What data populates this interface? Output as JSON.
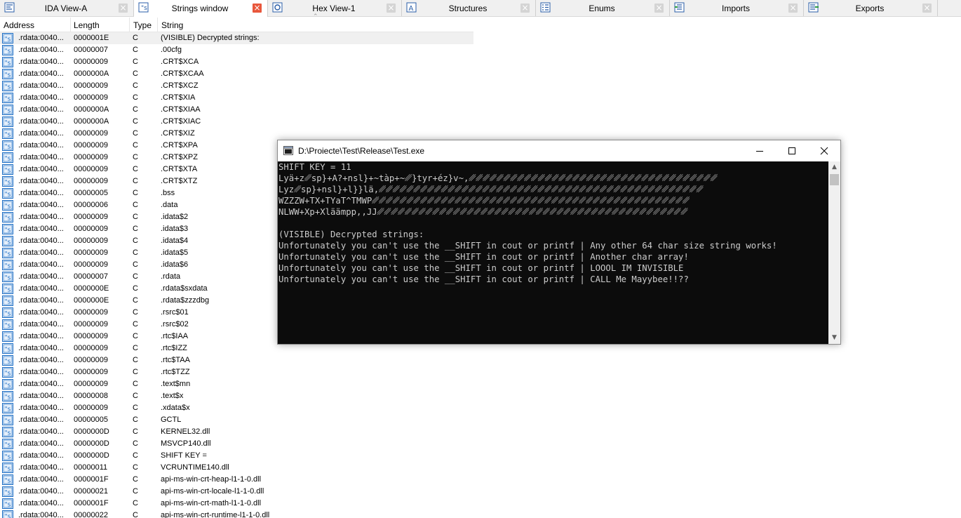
{
  "tabs": [
    {
      "label": "IDA View-A",
      "icon": "ida-view-icon",
      "active": false
    },
    {
      "label": "Strings window",
      "icon": "strings-icon",
      "active": true
    },
    {
      "label": "Hex View-1",
      "icon": "hex-view-icon",
      "active": false
    },
    {
      "label": "Structures",
      "icon": "structures-icon",
      "active": false
    },
    {
      "label": "Enums",
      "icon": "enums-icon",
      "active": false
    },
    {
      "label": "Imports",
      "icon": "imports-icon",
      "active": false
    },
    {
      "label": "Exports",
      "icon": "exports-icon",
      "active": false
    }
  ],
  "strings_table": {
    "columns": [
      "Address",
      "Length",
      "Type",
      "String"
    ],
    "rows": [
      {
        "address": ".rdata:0040...",
        "length": "0000001E",
        "type": "C",
        "string": "(VISIBLE) Decrypted strings:"
      },
      {
        "address": ".rdata:0040...",
        "length": "00000007",
        "type": "C",
        "string": ".00cfg"
      },
      {
        "address": ".rdata:0040...",
        "length": "00000009",
        "type": "C",
        "string": ".CRT$XCA"
      },
      {
        "address": ".rdata:0040...",
        "length": "0000000A",
        "type": "C",
        "string": ".CRT$XCAA"
      },
      {
        "address": ".rdata:0040...",
        "length": "00000009",
        "type": "C",
        "string": ".CRT$XCZ"
      },
      {
        "address": ".rdata:0040...",
        "length": "00000009",
        "type": "C",
        "string": ".CRT$XIA"
      },
      {
        "address": ".rdata:0040...",
        "length": "0000000A",
        "type": "C",
        "string": ".CRT$XIAA"
      },
      {
        "address": ".rdata:0040...",
        "length": "0000000A",
        "type": "C",
        "string": ".CRT$XIAC"
      },
      {
        "address": ".rdata:0040...",
        "length": "00000009",
        "type": "C",
        "string": ".CRT$XIZ"
      },
      {
        "address": ".rdata:0040...",
        "length": "00000009",
        "type": "C",
        "string": ".CRT$XPA"
      },
      {
        "address": ".rdata:0040...",
        "length": "00000009",
        "type": "C",
        "string": ".CRT$XPZ"
      },
      {
        "address": ".rdata:0040...",
        "length": "00000009",
        "type": "C",
        "string": ".CRT$XTA"
      },
      {
        "address": ".rdata:0040...",
        "length": "00000009",
        "type": "C",
        "string": ".CRT$XTZ"
      },
      {
        "address": ".rdata:0040...",
        "length": "00000005",
        "type": "C",
        "string": ".bss"
      },
      {
        "address": ".rdata:0040...",
        "length": "00000006",
        "type": "C",
        "string": ".data"
      },
      {
        "address": ".rdata:0040...",
        "length": "00000009",
        "type": "C",
        "string": ".idata$2"
      },
      {
        "address": ".rdata:0040...",
        "length": "00000009",
        "type": "C",
        "string": ".idata$3"
      },
      {
        "address": ".rdata:0040...",
        "length": "00000009",
        "type": "C",
        "string": ".idata$4"
      },
      {
        "address": ".rdata:0040...",
        "length": "00000009",
        "type": "C",
        "string": ".idata$5"
      },
      {
        "address": ".rdata:0040...",
        "length": "00000009",
        "type": "C",
        "string": ".idata$6"
      },
      {
        "address": ".rdata:0040...",
        "length": "00000007",
        "type": "C",
        "string": ".rdata"
      },
      {
        "address": ".rdata:0040...",
        "length": "0000000E",
        "type": "C",
        "string": ".rdata$sxdata"
      },
      {
        "address": ".rdata:0040...",
        "length": "0000000E",
        "type": "C",
        "string": ".rdata$zzzdbg"
      },
      {
        "address": ".rdata:0040...",
        "length": "00000009",
        "type": "C",
        "string": ".rsrc$01"
      },
      {
        "address": ".rdata:0040...",
        "length": "00000009",
        "type": "C",
        "string": ".rsrc$02"
      },
      {
        "address": ".rdata:0040...",
        "length": "00000009",
        "type": "C",
        "string": ".rtc$IAA"
      },
      {
        "address": ".rdata:0040...",
        "length": "00000009",
        "type": "C",
        "string": ".rtc$IZZ"
      },
      {
        "address": ".rdata:0040...",
        "length": "00000009",
        "type": "C",
        "string": ".rtc$TAA"
      },
      {
        "address": ".rdata:0040...",
        "length": "00000009",
        "type": "C",
        "string": ".rtc$TZZ"
      },
      {
        "address": ".rdata:0040...",
        "length": "00000009",
        "type": "C",
        "string": ".text$mn"
      },
      {
        "address": ".rdata:0040...",
        "length": "00000008",
        "type": "C",
        "string": ".text$x"
      },
      {
        "address": ".rdata:0040...",
        "length": "00000009",
        "type": "C",
        "string": ".xdata$x"
      },
      {
        "address": ".rdata:0040...",
        "length": "00000005",
        "type": "C",
        "string": "GCTL"
      },
      {
        "address": ".rdata:0040...",
        "length": "0000000D",
        "type": "C",
        "string": "KERNEL32.dll"
      },
      {
        "address": ".rdata:0040...",
        "length": "0000000D",
        "type": "C",
        "string": "MSVCP140.dll"
      },
      {
        "address": ".rdata:0040...",
        "length": "0000000D",
        "type": "C",
        "string": "SHIFT KEY ="
      },
      {
        "address": ".rdata:0040...",
        "length": "00000011",
        "type": "C",
        "string": "VCRUNTIME140.dll"
      },
      {
        "address": ".rdata:0040...",
        "length": "0000001F",
        "type": "C",
        "string": "api-ms-win-crt-heap-l1-1-0.dll"
      },
      {
        "address": ".rdata:0040...",
        "length": "00000021",
        "type": "C",
        "string": "api-ms-win-crt-locale-l1-1-0.dll"
      },
      {
        "address": ".rdata:0040...",
        "length": "0000001F",
        "type": "C",
        "string": "api-ms-win-crt-math-l1-1-0.dll"
      },
      {
        "address": ".rdata:0040...",
        "length": "00000022",
        "type": "C",
        "string": "api-ms-win-crt-runtime-l1-1-0.dll"
      }
    ]
  },
  "console": {
    "title": "D:\\Proiecte\\Test\\Release\\Test.exe",
    "lines": [
      "SHIFT KEY = 11",
      "Lyä+z␥sp}+A?+nsl}+~tàp+~␥}tyr+éz}v~,␥␥␥␥␥␥␥␥␥␥␥␥␥␥␥␥␥␥␥␥␥␥␥␥␥␥␥␥␥␥␥␥␥␥␥␥",
      "Lyz␥sp}+nsl}+l}}lä,␥␥␥␥␥␥␥␥␥␥␥␥␥␥␥␥␥␥␥␥␥␥␥␥␥␥␥␥␥␥␥␥␥␥␥␥␥␥␥␥␥␥␥␥␥␥␥",
      "WZZZW+TX+TYaT^TMWP␥␥␥␥␥␥␥␥␥␥␥␥␥␥␥␥␥␥␥␥␥␥␥␥␥␥␥␥␥␥␥␥␥␥␥␥␥␥␥␥␥␥␥␥␥␥",
      "NLWW+Xp+Xläämpp,,JJ␥␥␥␥␥␥␥␥␥␥␥␥␥␥␥␥␥␥␥␥␥␥␥␥␥␥␥␥␥␥␥␥␥␥␥␥␥␥␥␥␥␥␥␥␥",
      "",
      "(VISIBLE) Decrypted strings:",
      "Unfortunately you can't use the __SHIFT in cout or printf | Any other 64 char size string works!",
      "Unfortunately you can't use the __SHIFT in cout or printf | Another char array!",
      "Unfortunately you can't use the __SHIFT in cout or printf | LOOOL IM INVISIBLE",
      "Unfortunately you can't use the __SHIFT in cout or printf | CALL Me Mayybee!!??"
    ]
  },
  "colors": {
    "tab_close_active": "#e8573c",
    "tab_close_inactive": "#d4d4d4",
    "terminal_bg": "#0c0c0c",
    "terminal_fg": "#cccccc",
    "string_icon_blue": "#1f6fc5",
    "selected_row": "#f0f0f0"
  }
}
